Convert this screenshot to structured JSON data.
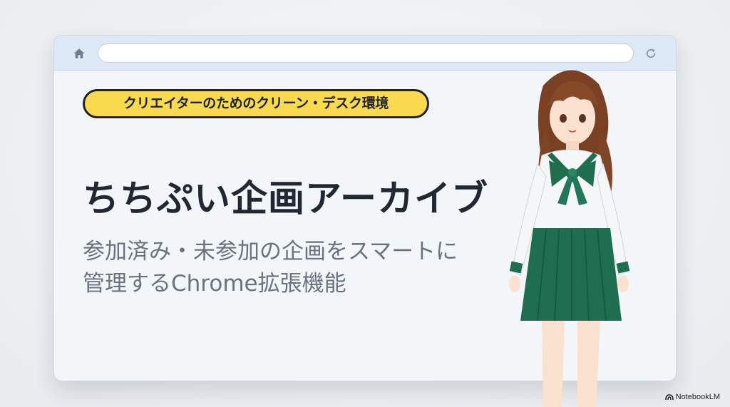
{
  "browser": {
    "address": {
      "value": "",
      "placeholder": ""
    }
  },
  "slide": {
    "tag": "クリエイターのためのクリーン・デスク環境",
    "title": "ちちぷい企画アーカイブ",
    "subtitle_lines": [
      "参加済み・未参加の企画をスマートに",
      "管理するChrome拡張機能"
    ]
  },
  "watermark": {
    "label": "NotebookLM"
  },
  "colors": {
    "accent_yellow": "#f9d94e",
    "title_text": "#232734",
    "subtitle_text": "#6a7280",
    "toolbar_bg": "#dde9f7",
    "uniform_green": "#1f6e4f"
  },
  "icons": {
    "home": "home-icon",
    "reload": "reload-icon",
    "watermark": "notebooklm-logo-icon"
  }
}
